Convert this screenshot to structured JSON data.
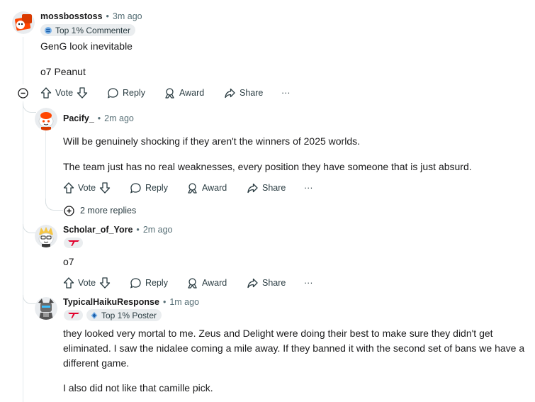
{
  "comments": [
    {
      "username": "mossbosstoss",
      "time": "3m ago",
      "badge": "Top 1% Commenter",
      "paragraphs": [
        "GenG look inevitable",
        "o7 Peanut"
      ],
      "actions": {
        "vote": "Vote",
        "reply": "Reply",
        "award": "Award",
        "share": "Share",
        "more": "···"
      }
    },
    {
      "username": "Pacify_",
      "time": "2m ago",
      "paragraphs": [
        "Will be genuinely shocking if they aren't the winners of 2025 worlds.",
        "The team just has no real weaknesses, every position they have someone that is just absurd."
      ],
      "actions": {
        "vote": "Vote",
        "reply": "Reply",
        "award": "Award",
        "share": "Share",
        "more": "···"
      },
      "more_replies": "2 more replies"
    },
    {
      "username": "Scholar_of_Yore",
      "time": "2m ago",
      "paragraphs": [
        "o7"
      ],
      "actions": {
        "vote": "Vote",
        "reply": "Reply",
        "award": "Award",
        "share": "Share",
        "more": "···"
      }
    },
    {
      "username": "TypicalHaikuResponse",
      "time": "1m ago",
      "badge": "Top 1% Poster",
      "paragraphs": [
        "they looked very mortal to me. Zeus and Delight were doing their best to make sure they didn't get eliminated. I saw the nidalee coming a mile away. If they banned it with the second set of bans we have a different game.",
        "I also did not like that camille pick."
      ]
    }
  ],
  "separator": "•",
  "colors": {
    "brand_red": "#e2012d",
    "meta": "#576f76",
    "thread_line": "#e5ebee"
  },
  "icons": {
    "collapse": "minus-circle-icon",
    "upvote": "arrow-up-icon",
    "downvote": "arrow-down-icon",
    "reply": "speech-bubble-icon",
    "award": "award-icon",
    "share": "share-icon",
    "expand": "plus-circle-icon"
  }
}
